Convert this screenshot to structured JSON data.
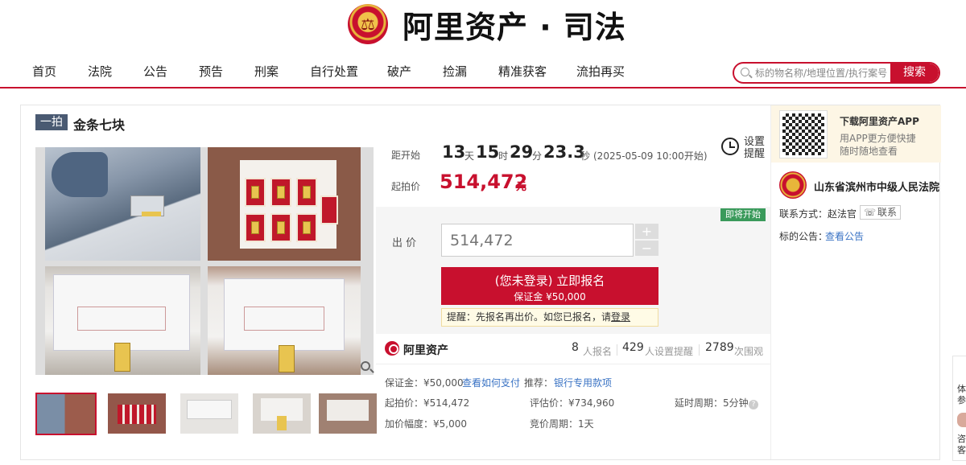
{
  "header": {
    "logo_text": "阿里资产 · 司法"
  },
  "nav": {
    "items": [
      "首页",
      "法院",
      "公告",
      "预告",
      "刑案",
      "自行处置",
      "破产",
      "捡漏",
      "精准获客",
      "流拍再买"
    ],
    "search_placeholder": "标的物名称/地理位置/执行案号",
    "search_button": "搜索"
  },
  "item": {
    "badge": "一拍",
    "title": "金条七块"
  },
  "countdown": {
    "label": "距开始",
    "days": "13",
    "days_unit": "天",
    "hours": "15",
    "hours_unit": "时",
    "minutes": "29",
    "minutes_unit": "分",
    "seconds": "23.3",
    "seconds_unit": "秒",
    "start_note": "(2025-05-09 10:00开始)",
    "remind_label": "设置提醒"
  },
  "starting_price": {
    "label": "起拍价",
    "value": "514,472",
    "unit": "元"
  },
  "bid": {
    "status_tag": "即将开始",
    "label": "出 价",
    "placeholder": "514,472",
    "plus": "+",
    "minus": "−",
    "signup_line1": "(您未登录) 立即报名",
    "signup_line2": "保证金 ¥50,000",
    "tip_text": "提醒：先报名再出价。如您已报名，请",
    "tip_link": "登录"
  },
  "stats": {
    "brand": "阿里资产",
    "signups": "8",
    "signups_label": "人报名",
    "reminders": "429",
    "reminders_label": "人设置提醒",
    "views": "2789",
    "views_label": "次围观"
  },
  "details": {
    "deposit_label": "保证金：¥50,000",
    "deposit_link": "查看如何支付",
    "recommend_label": "推荐：",
    "recommend_link": "银行专用款项",
    "start_price": "起拍价：¥514,472",
    "appraisal": "评估价：¥734,960",
    "delay": "延时周期：5分钟",
    "increment": "加价幅度：¥5,000",
    "bidding_cycle": "竞价周期：1天"
  },
  "sidebar": {
    "app_title": "下载阿里资产APP",
    "app_sub1": "用APP更方便快捷",
    "app_sub2": "随时随地查看",
    "court_name": "山东省滨州市中级人民法院",
    "contact_label": "联系方式：赵法官",
    "contact_button": "联系",
    "notice_label": "标的公告：",
    "notice_link": "查看公告"
  },
  "floater": {
    "text1": "体",
    "text2": "参",
    "text3": "咨",
    "text4": "客"
  },
  "colors": {
    "brand_red": "#c8102e",
    "badge_bg": "#4a5a72",
    "status_green": "#3a9a5b",
    "link_blue": "#3a73c4"
  },
  "icons": [
    "search-icon",
    "zoom-icon",
    "clock-icon",
    "brand-logo-icon",
    "help-icon",
    "qr-code",
    "court-emblem-icon",
    "phone-icon"
  ]
}
